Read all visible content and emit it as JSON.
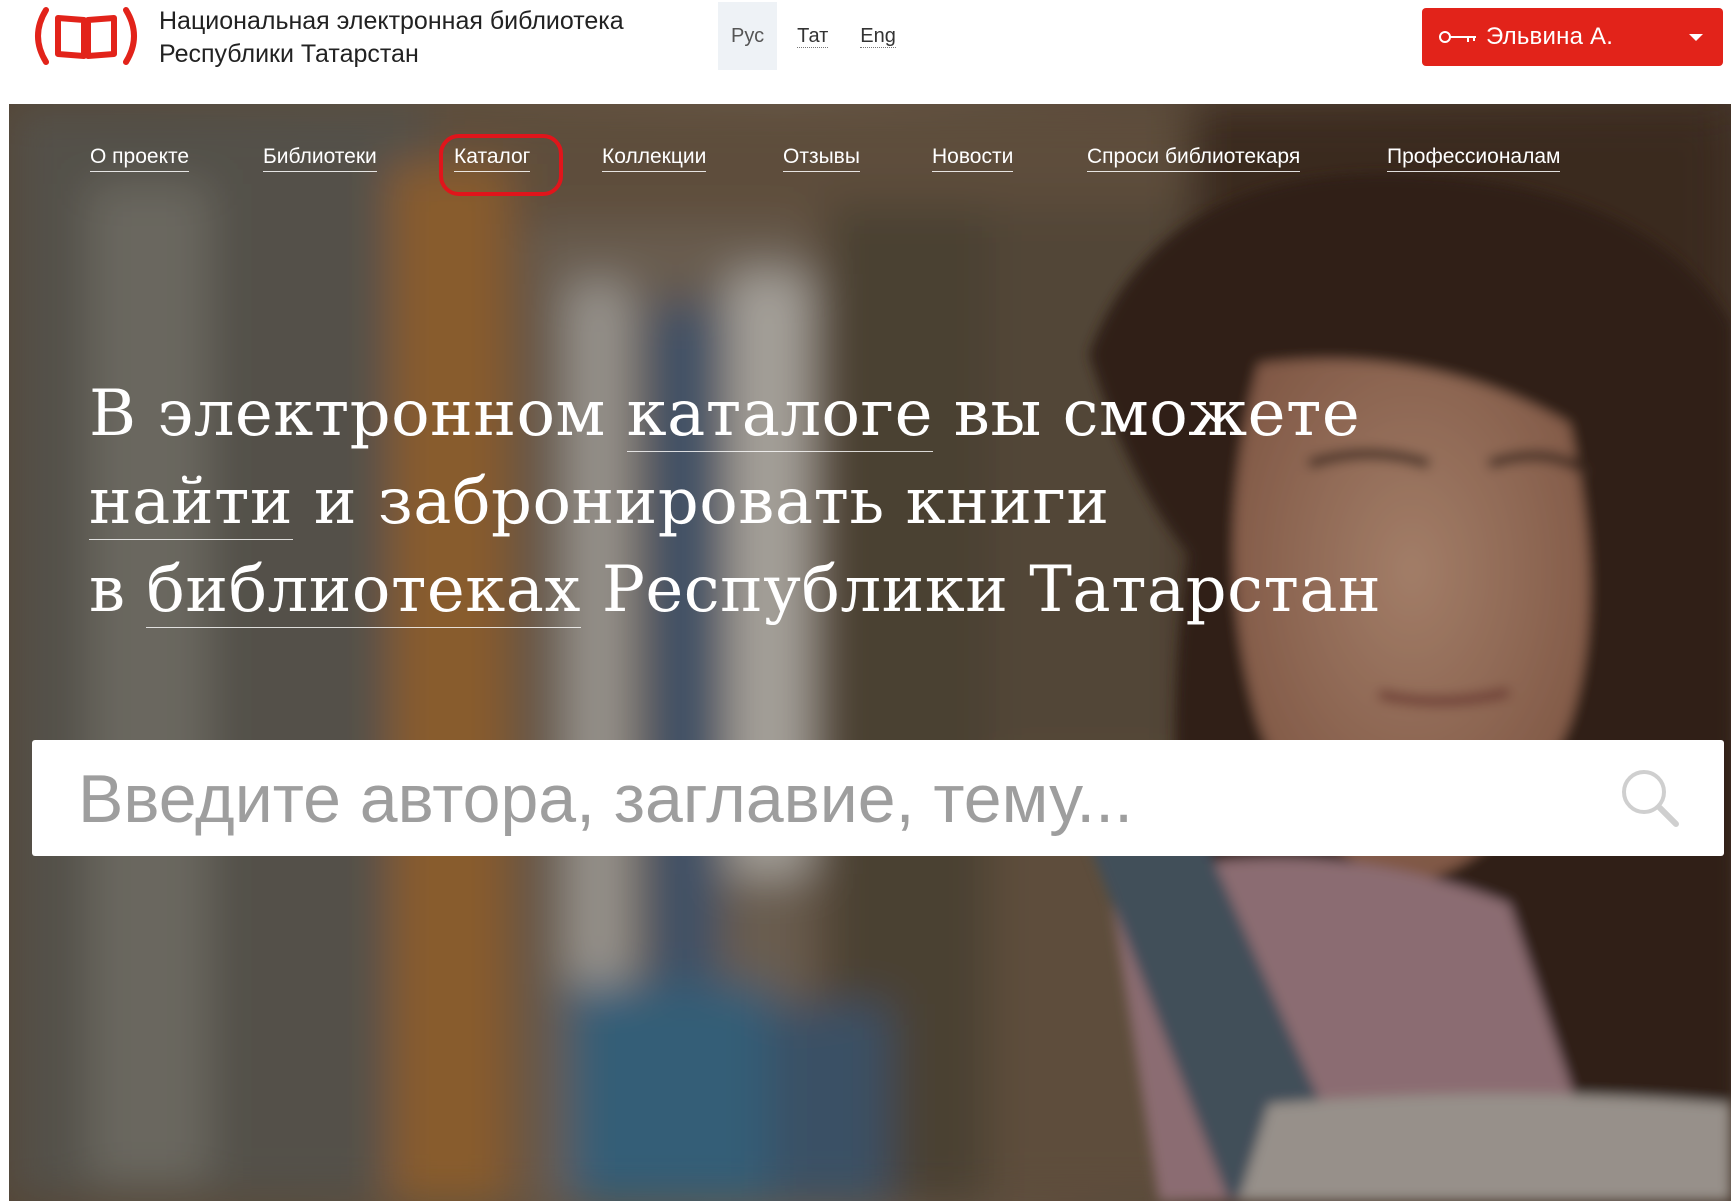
{
  "header": {
    "title_line1": "Национальная электронная библиотека",
    "title_line2": "Республики Татарстан",
    "logo_icon": "book-in-brackets-icon",
    "brand_color": "#e2231a",
    "languages": [
      {
        "label": "Рус",
        "active": true
      },
      {
        "label": "Тат",
        "active": false
      },
      {
        "label": "Eng",
        "active": false
      }
    ],
    "user": {
      "name": "Эльвина А.",
      "icon": "key-icon",
      "dropdown_icon": "caret-down-icon"
    }
  },
  "nav": {
    "items": [
      {
        "label": "О проекте"
      },
      {
        "label": "Библиотеки"
      },
      {
        "label": "Каталог",
        "highlighted": true
      },
      {
        "label": "Коллекции"
      },
      {
        "label": "Отзывы"
      },
      {
        "label": "Новости"
      },
      {
        "label": "Спроси библиотекаря"
      },
      {
        "label": "Профессионалам"
      }
    ],
    "highlight_color": "#e0151b"
  },
  "hero": {
    "line1_part1": "В электронном ",
    "line1_link": "каталоге",
    "line1_part2": " вы сможете",
    "line2_link": "найти",
    "line2_part2": " и забронировать книги",
    "line3_part1": "в ",
    "line3_link": "библиотеках",
    "line3_part2": " Республики Татарстан"
  },
  "search": {
    "placeholder": "Введите автора, заглавие, тему...",
    "value": "",
    "icon": "search-icon"
  }
}
